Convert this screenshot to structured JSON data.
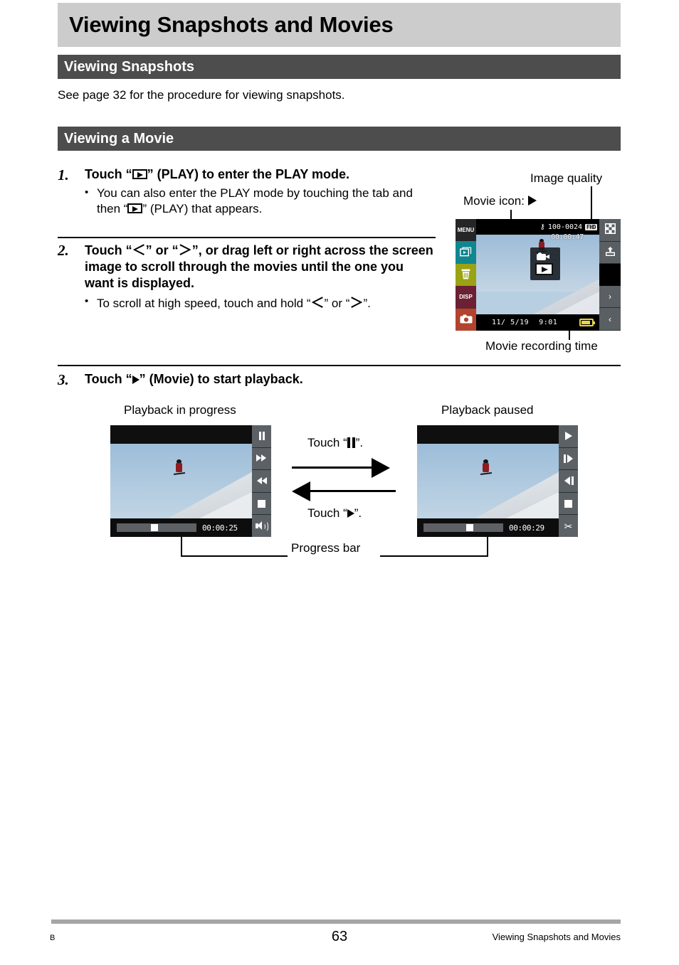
{
  "header": {
    "chapter_title": "Viewing Snapshots and Movies"
  },
  "sections": {
    "snapshots_bar": "Viewing Snapshots",
    "snapshots_text": "See page 32 for the procedure for viewing snapshots.",
    "movie_bar": "Viewing a Movie"
  },
  "steps": [
    {
      "number": "1.",
      "head_pre": "Touch “",
      "head_post": "” (PLAY) to enter the PLAY mode.",
      "bullet_pre": "You can also enter the PLAY mode by touching the tab and then “",
      "bullet_post": "” (PLAY) that appears."
    },
    {
      "number": "2.",
      "head_a": "Touch “",
      "head_lt": "＜",
      "head_b": "” or “",
      "head_gt": "＞",
      "head_c": "”, or drag left or right across the screen image to scroll through the movies until the one you want is displayed.",
      "bullet_a": "To scroll at high speed, touch and hold “",
      "bullet_lt": "＜",
      "bullet_b": "” or “",
      "bullet_gt": "＞",
      "bullet_c": "”."
    },
    {
      "number": "3.",
      "head_pre": "Touch “",
      "head_post": "” (Movie) to start playback."
    }
  ],
  "camera_callouts": {
    "image_quality": "Image quality",
    "movie_icon": "Movie icon:",
    "movie_recording_time": "Movie recording time"
  },
  "camera_screen": {
    "left_buttons": [
      {
        "name": "menu",
        "label": "MENU",
        "color": "#262626"
      },
      {
        "name": "slideshow",
        "label": "",
        "color": "#11868f"
      },
      {
        "name": "delete",
        "label": "",
        "color": "#9aa312"
      },
      {
        "name": "disp",
        "label": "DISP",
        "color": "#6b2034"
      },
      {
        "name": "record-mode",
        "label": "",
        "color": "#b1442c"
      }
    ],
    "right_buttons": [
      {
        "name": "mosaic",
        "label": ""
      },
      {
        "name": "upload",
        "label": ""
      },
      {
        "name": "blank",
        "label": ""
      },
      {
        "name": "next",
        "label": "›"
      },
      {
        "name": "prev",
        "label": "‹"
      }
    ],
    "file_number": "100-0024",
    "quality_badge": "FHD",
    "recording_time": "00:00:47",
    "date": "11/ 5/19",
    "time": "9:01"
  },
  "playback": {
    "left_label": "Playback in progress",
    "right_label": "Playback paused",
    "progress_bar_label": "Progress bar",
    "touch_pause_pre": "Touch “",
    "touch_pause_post": "”.",
    "touch_play_pre": "Touch “",
    "touch_play_post": "”.",
    "in_progress": {
      "time": "00:00:25",
      "buttons": [
        "pause",
        "fast-forward",
        "rewind",
        "stop",
        "volume"
      ]
    },
    "paused": {
      "time": "00:00:29",
      "buttons": [
        "play",
        "frame-forward",
        "frame-back",
        "stop",
        "cut"
      ]
    }
  },
  "footer": {
    "left_mark": "B",
    "page_number": "63",
    "right_text": "Viewing Snapshots and Movies"
  },
  "colors": {
    "title_bg": "#cccccc",
    "section_bg": "#4d4d4d",
    "footer_rule": "#a6a6a6"
  }
}
